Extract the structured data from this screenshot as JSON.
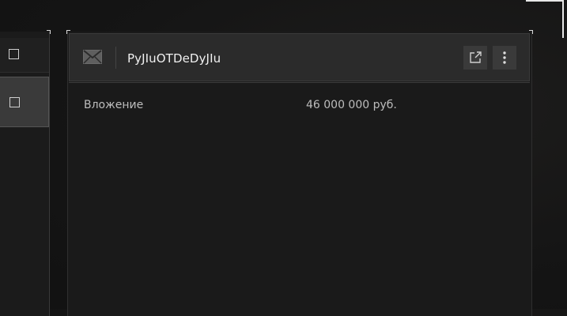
{
  "message": {
    "sender": "PyJIuOTDeDyJIu",
    "icon": "mail-icon",
    "actions": {
      "open_icon": "external-link-icon",
      "more_icon": "more-vertical-icon"
    },
    "fields": [
      {
        "label": "Вложение",
        "value": "46 000 000 руб."
      }
    ]
  },
  "colors": {
    "background": "#141414",
    "card": "#1a1a1a",
    "header": "#2b2b2b",
    "button": "#3a3a3a",
    "text": "#f0f0f0",
    "muted_text": "#bdbdbd"
  }
}
